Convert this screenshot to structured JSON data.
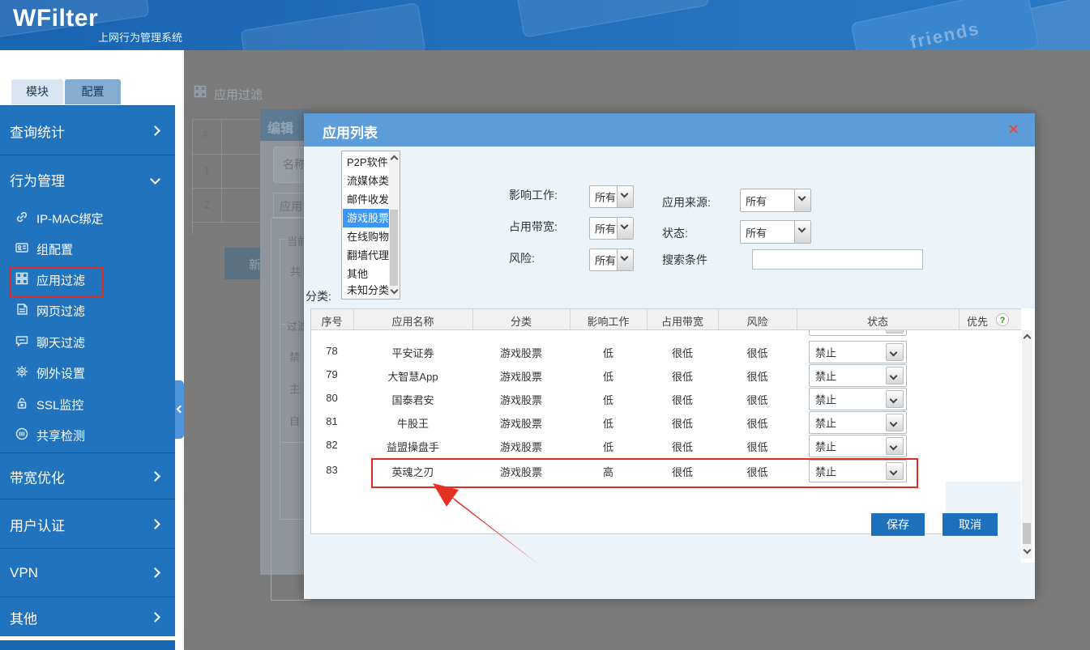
{
  "colors": {
    "banner_blue": "#2173bd",
    "sidebar_blue": "#2173bd",
    "modal_header_blue": "#5b9cd9",
    "selection_blue": "#3b96f7",
    "button_blue": "#1e70bc",
    "annotation_red": "#e02b20",
    "help_green": "#3a8f1e"
  },
  "banner": {
    "logo": "WFilter",
    "subtitle": "上网行为管理系统",
    "keycap_text": "friends"
  },
  "sidebar": {
    "tabs": [
      {
        "label": "模块"
      },
      {
        "label": "配置"
      }
    ],
    "top_items": [
      {
        "label": "查询统计"
      },
      {
        "label": "行为管理"
      },
      {
        "label": "带宽优化"
      },
      {
        "label": "用户认证"
      },
      {
        "label": "VPN"
      },
      {
        "label": "其他"
      }
    ],
    "sub_items": [
      {
        "icon": "link-icon",
        "label": "IP-MAC绑定"
      },
      {
        "icon": "id-card-icon",
        "label": "组配置"
      },
      {
        "icon": "grid-icon",
        "label": "应用过滤"
      },
      {
        "icon": "webpage-icon",
        "label": "网页过滤"
      },
      {
        "icon": "chat-icon",
        "label": "聊天过滤"
      },
      {
        "icon": "gear-icon",
        "label": "例外设置"
      },
      {
        "icon": "lock-icon",
        "label": "SSL监控"
      },
      {
        "icon": "share-icon",
        "label": "共享检测"
      }
    ]
  },
  "background": {
    "page_title": "应用过滤",
    "list_header": "#",
    "row1": "1",
    "row2": "2",
    "new_button": "新",
    "edit_dialog": {
      "title": "编辑",
      "name_label": "名称",
      "tab_label": "应用",
      "group1": "当前",
      "group1_item": "共",
      "group2": "过滤",
      "item_a": "禁",
      "item_b": "主",
      "item_c": "自"
    }
  },
  "modal": {
    "title": "应用列表",
    "close": "✕",
    "category_label": "分类:",
    "categories": [
      {
        "label": "P2P软件"
      },
      {
        "label": "流媒体类"
      },
      {
        "label": "邮件收发"
      },
      {
        "label": "游戏股票",
        "selected": true
      },
      {
        "label": "在线购物"
      },
      {
        "label": "翻墙代理"
      },
      {
        "label": "其他"
      },
      {
        "label": "未知分类"
      }
    ],
    "filters": {
      "impact_label": "影响工作:",
      "impact_value": "所有",
      "bandwidth_label": "占用带宽:",
      "bandwidth_value": "所有",
      "risk_label": "风险:",
      "risk_value": "所有",
      "source_label": "应用来源:",
      "source_value": "所有",
      "status_label": "状态:",
      "status_value": "所有",
      "search_label": "搜索条件",
      "search_value": ""
    },
    "table": {
      "headers": [
        "序号",
        "应用名称",
        "分类",
        "影响工作",
        "占用带宽",
        "风险",
        "状态",
        "优先"
      ],
      "help": "?",
      "rows": [
        {
          "seq": "78",
          "name": "平安证券",
          "category": "游戏股票",
          "impact": "低",
          "bandwidth": "很低",
          "risk": "很低",
          "status": "禁止"
        },
        {
          "seq": "79",
          "name": "大智慧App",
          "category": "游戏股票",
          "impact": "低",
          "bandwidth": "很低",
          "risk": "很低",
          "status": "禁止"
        },
        {
          "seq": "80",
          "name": "国泰君安",
          "category": "游戏股票",
          "impact": "低",
          "bandwidth": "很低",
          "risk": "很低",
          "status": "禁止"
        },
        {
          "seq": "81",
          "name": "牛股王",
          "category": "游戏股票",
          "impact": "低",
          "bandwidth": "很低",
          "risk": "很低",
          "status": "禁止"
        },
        {
          "seq": "82",
          "name": "益盟操盘手",
          "category": "游戏股票",
          "impact": "低",
          "bandwidth": "很低",
          "risk": "很低",
          "status": "禁止"
        },
        {
          "seq": "83",
          "name": "英魂之刃",
          "category": "游戏股票",
          "impact": "高",
          "bandwidth": "很低",
          "risk": "很低",
          "status": "禁止"
        }
      ]
    },
    "save": "保存",
    "cancel": "取消"
  }
}
